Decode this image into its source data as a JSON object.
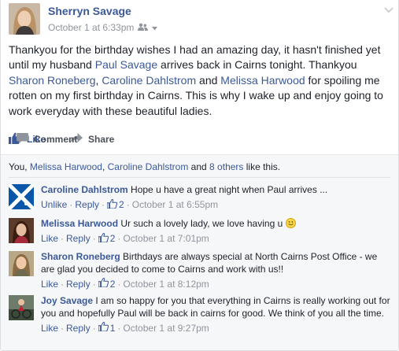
{
  "post": {
    "author": "Sherryn Savage",
    "timestamp": "October 1 at 6:33pm",
    "audience_icon": "friends-icon",
    "text": {
      "p1": "Thankyou for the birthday wishes I had an amazing day, it hasn't finished yet until my husband ",
      "tag1": "Paul Savage",
      "p2": " arrives back in Cairns tonight. Thankyou ",
      "tag2": "Sharon Roneberg",
      "p3": ", ",
      "tag3": "Caroline Dahlstrom",
      "p4": " and ",
      "tag4": "Melissa Harwood",
      "p5": " for spoiling me rotten on my first birthday in Cairns. This is why I wake up and enjoy going to work everyday with these beautiful ladies."
    }
  },
  "actions": {
    "like": "Like",
    "comment": "Comment",
    "share": "Share"
  },
  "likes_summary": {
    "you": "You",
    "sep1": ", ",
    "name1": "Melissa Harwood",
    "sep2": ", ",
    "name2": "Caroline Dahlstrom",
    "and": " and ",
    "others": "8 others",
    "suffix": " like this."
  },
  "comments": [
    {
      "name": "Caroline Dahlstrom",
      "text": "Hope u have a great night when Paul arrives ...",
      "action1": "Unlike",
      "reply": "Reply",
      "likes": "2",
      "time": "October 1 at 6:55pm"
    },
    {
      "name": "Melissa Harwood",
      "text": "Ur such a lovely lady, we love having u",
      "emoji": "smiley-emoji",
      "action1": "Like",
      "reply": "Reply",
      "likes": "2",
      "time": "October 1 at 7:01pm"
    },
    {
      "name": "Sharon Roneberg",
      "text": "Birthdays are always special at North Cairns Post Office - we are glad you decided to come to Cairns and work with us!!",
      "action1": "Like",
      "reply": "Reply",
      "likes": "2",
      "time": "October 1 at 8:12pm"
    },
    {
      "name": "Joy Savage",
      "text": "I am so happy for you that everything in Cairns is really working out for you and hopefully Paul will be back in cairns for good. We think of you all the time.",
      "action1": "Like",
      "reply": "Reply",
      "likes": "1",
      "time": "October 1 at 9:27pm"
    }
  ],
  "colors": {
    "link": "#3b5998",
    "meta": "#90949c",
    "ufi_bg": "#f6f7f9"
  }
}
